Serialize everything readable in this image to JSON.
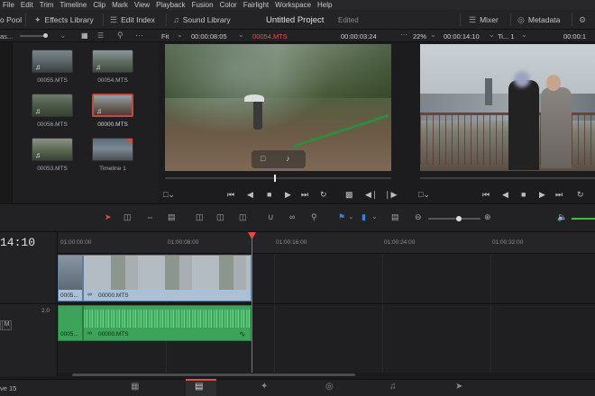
{
  "menu": [
    "File",
    "Edit",
    "Trim",
    "Timeline",
    "Clip",
    "Mark",
    "View",
    "Playback",
    "Fusion",
    "Color",
    "Fairlight",
    "Workspace",
    "Help"
  ],
  "toolbar": {
    "media_pool": "o Pool",
    "effects_library": "Effects Library",
    "edit_index": "Edit Index",
    "sound_library": "Sound Library",
    "project_title": "Untitled Project",
    "edited_status": "Edited",
    "mixer": "Mixer",
    "metadata": "Metadata"
  },
  "media_pool": {
    "bin_name": "as...",
    "clips": [
      {
        "name": "00055.MTS"
      },
      {
        "name": "00054.MTS"
      },
      {
        "name": "00056.MTS"
      },
      {
        "name": "00000.MTS"
      },
      {
        "name": "00053.MTS"
      },
      {
        "name": "Timeline 1"
      }
    ]
  },
  "source_viewer": {
    "zoom": "Fit",
    "timecode_left": "00:00:08:05",
    "clip_name": "00054.MTS",
    "timecode_right": "00:00:03:24"
  },
  "timeline_viewer": {
    "zoom": "22%",
    "timecode": "00:00:14:10",
    "timeline_name": "Ti... 1",
    "timecode_right": "00:00:1"
  },
  "timeline": {
    "current_timecode": "14:10",
    "ruler_ticks": [
      "01:00:00:00",
      "01:00:08:00",
      "01:00:16:00",
      "01:00:24:00",
      "01:00:32:00"
    ],
    "video_clip_a": "0005...",
    "video_clip_b": "00000.MTS",
    "audio_level": "2.0",
    "audio_mute": "M",
    "audio_clip_a": "0005...",
    "audio_clip_b": "00000.MTS"
  },
  "footer": {
    "version": "ve 15"
  }
}
